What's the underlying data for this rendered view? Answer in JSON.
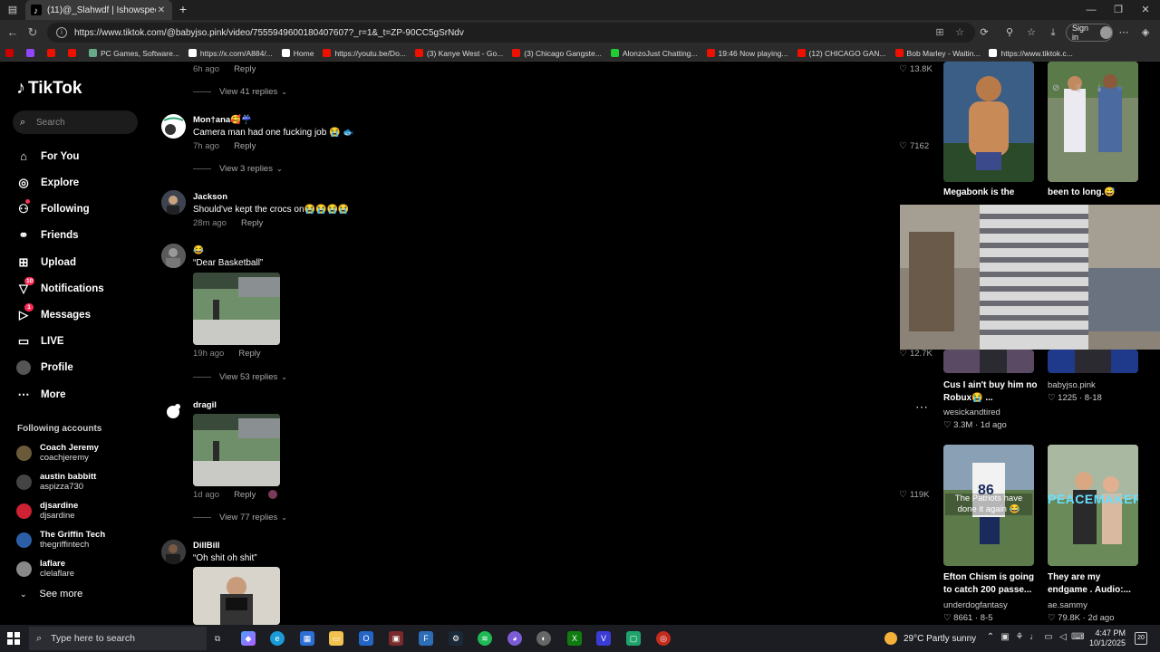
{
  "browser": {
    "tab_title": "(11)@_Slahwdf | Ishowspeed | ...",
    "url": "https://www.tiktok.com/@babyjso.pink/video/7555949600180407607?_r=1&_t=ZP-90CC5gSrNdv",
    "signin_label": "Sign in",
    "bookmarks": [
      {
        "label": "",
        "color": "#c00"
      },
      {
        "label": "",
        "color": "#9146ff"
      },
      {
        "label": "",
        "color": "#e10"
      },
      {
        "label": "",
        "color": "#e10"
      },
      {
        "label": "PC Games, Software...",
        "color": "#6a8"
      },
      {
        "label": "https://x.com/A884/...",
        "color": "#fff"
      },
      {
        "label": "Home",
        "color": "#fff"
      },
      {
        "label": "https://youtu.be/Do...",
        "color": "#e10"
      },
      {
        "label": "(3) Kanye West - Go...",
        "color": "#e10"
      },
      {
        "label": "(3) Chicago Gangste...",
        "color": "#e10"
      },
      {
        "label": "AlonzoJust Chatting...",
        "color": "#2c3"
      },
      {
        "label": "19:46 Now playing...",
        "color": "#e10"
      },
      {
        "label": "(12) CHICAGO GAN...",
        "color": "#e10"
      },
      {
        "label": "Bob Marley - Waitin...",
        "color": "#e10"
      },
      {
        "label": "https://www.tiktok.c...",
        "color": "#fff"
      }
    ]
  },
  "sidebar": {
    "logo": "TikTok",
    "search_placeholder": "Search",
    "nav": [
      {
        "label": "For You",
        "icon": "home-icon"
      },
      {
        "label": "Explore",
        "icon": "compass-icon"
      },
      {
        "label": "Following",
        "icon": "user-follow-icon"
      },
      {
        "label": "Friends",
        "icon": "friends-icon"
      },
      {
        "label": "Upload",
        "icon": "upload-icon"
      },
      {
        "label": "Notifications",
        "icon": "inbox-icon",
        "badge": "10"
      },
      {
        "label": "Messages",
        "icon": "send-icon",
        "badge": "1"
      },
      {
        "label": "LIVE",
        "icon": "live-icon"
      },
      {
        "label": "Profile",
        "icon": "avatar"
      },
      {
        "label": "More",
        "icon": "more-icon"
      }
    ],
    "following_header": "Following accounts",
    "following": [
      {
        "name": "Coach Jeremy",
        "handle": "coachjeremy",
        "color": "#6b5a3a"
      },
      {
        "name": "austin babbitt",
        "handle": "aspizza730",
        "color": "#444"
      },
      {
        "name": "djsardine",
        "handle": "djsardine",
        "color": "#c23"
      },
      {
        "name": "The Griffin Tech",
        "handle": "thegriffintech",
        "color": "#2a5fa8"
      },
      {
        "name": "laflare",
        "handle": "clelaflare",
        "color": "#888"
      }
    ],
    "see_more": "See more"
  },
  "comments": {
    "top": {
      "time": "6h ago",
      "reply": "Reply",
      "likes": "13.8K",
      "view_replies": "View 41 replies"
    },
    "items": [
      {
        "user": "Mon†ana🥰☔",
        "text": "Camera man had one fucking job 😭 🐟",
        "time": "7h ago",
        "reply": "Reply",
        "likes": "7162",
        "view_replies": "View 3 replies"
      },
      {
        "user": "Jackson",
        "text": "Should've kept the crocs on😭😭😭😭",
        "time": "28m ago",
        "reply": "Reply",
        "likes": "",
        "view_replies": ""
      },
      {
        "user": "😂",
        "text": "“Dear Basketball”",
        "time": "19h ago",
        "reply": "Reply",
        "likes": "12.7K",
        "view_replies": "View 53 replies"
      },
      {
        "user": "dragil",
        "text": "",
        "time": "1d ago",
        "reply": "Reply",
        "likes": "119K",
        "view_replies": "View 77 replies"
      },
      {
        "user": "DillBill",
        "text": "“Oh shit oh shit”",
        "time": "",
        "reply": "",
        "likes": "",
        "view_replies": ""
      }
    ]
  },
  "right": {
    "videos": [
      {
        "title": "Megabonk is the",
        "author": "",
        "likes": "",
        "date": ""
      },
      {
        "title": "been to long.😅",
        "author": "",
        "likes": "",
        "date": ""
      },
      {
        "title": "Cus I ain't buy him no Robux😭 ...",
        "author": "wesickandtired",
        "likes": "3.3M",
        "date": "1d ago"
      },
      {
        "title": "",
        "author": "babyjso.pink",
        "likes": "1225",
        "date": "8-18"
      },
      {
        "title": "Efton Chism is going to catch 200 passe...",
        "author": "underdogfantasy",
        "likes": "8661",
        "date": "8-5",
        "overlay": "The Patriots have done it again 😂"
      },
      {
        "title": "They are my endgame . Audio:...",
        "author": "ae.sammy",
        "likes": "79.8K",
        "date": "2d ago",
        "overlay": "PEACEMAKER"
      }
    ]
  },
  "taskbar": {
    "search_placeholder": "Type here to search",
    "weather": "29°C  Partly sunny",
    "time": "4:47 PM",
    "date": "10/1/2025",
    "notif_count": "20"
  }
}
